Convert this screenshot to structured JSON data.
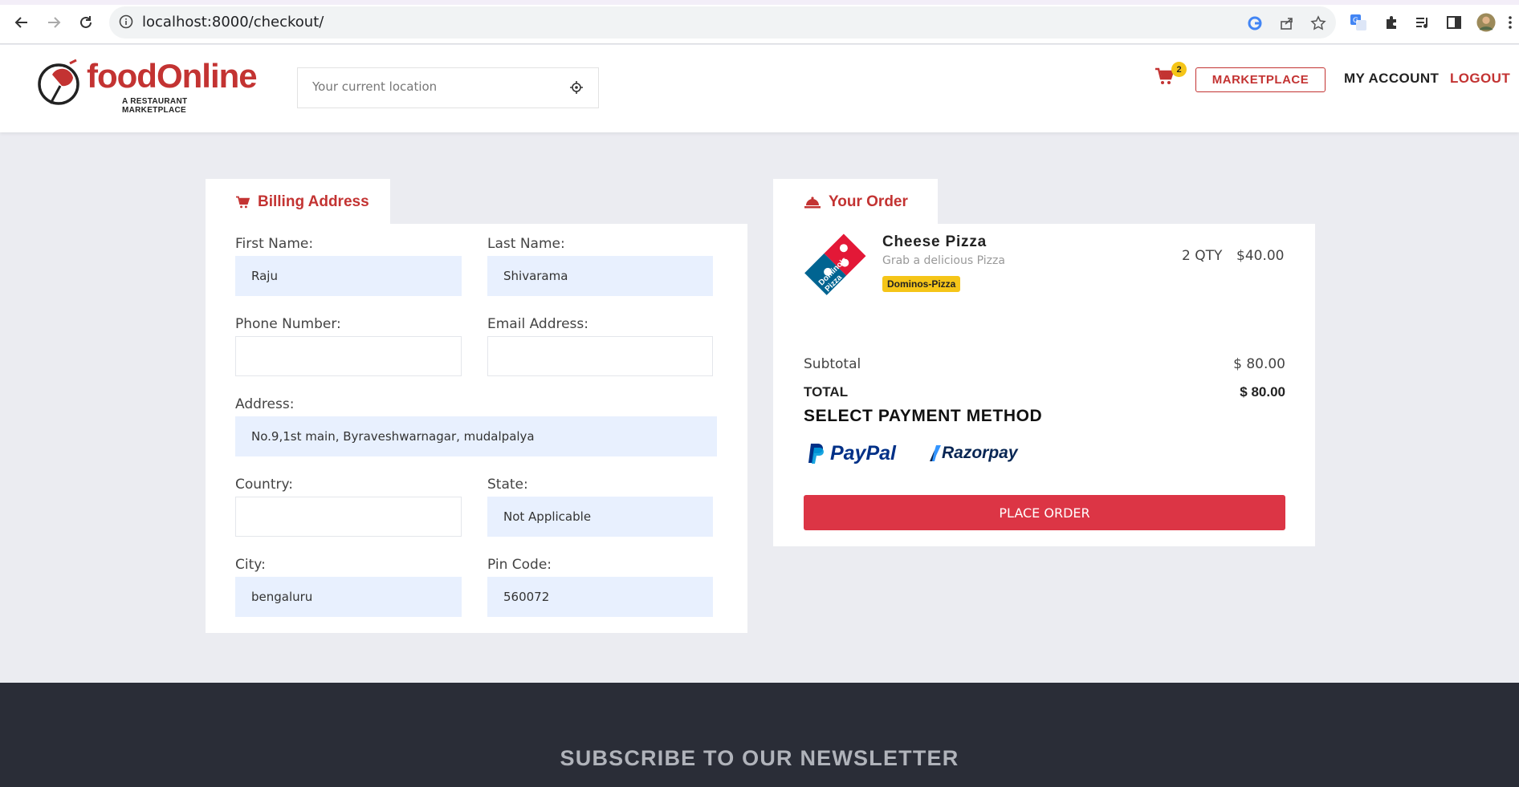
{
  "browser": {
    "url": "localhost:8000/checkout/"
  },
  "header": {
    "logo_text": "foodOnline",
    "logo_subtitle": "A RESTAURANT MARKETPLACE",
    "location_placeholder": "Your current location",
    "cart_count": "2",
    "marketplace_label": "MARKETPLACE",
    "my_account_label": "MY ACCOUNT",
    "logout_label": "LOGOUT"
  },
  "billing": {
    "tab_title": "Billing Address",
    "first_name": {
      "label": "First Name:",
      "value": "Raju"
    },
    "last_name": {
      "label": "Last Name:",
      "value": "Shivarama"
    },
    "phone": {
      "label": "Phone Number:",
      "value": ""
    },
    "email": {
      "label": "Email Address:",
      "value": ""
    },
    "address": {
      "label": "Address:",
      "value": "No.9,1st main, Byraveshwarnagar, mudalpalya"
    },
    "country": {
      "label": "Country:",
      "value": ""
    },
    "state": {
      "label": "State:",
      "value": "Not Applicable"
    },
    "city": {
      "label": "City:",
      "value": "bengaluru"
    },
    "pin_code": {
      "label": "Pin Code:",
      "value": "560072"
    }
  },
  "order": {
    "tab_title": "Your Order",
    "items": [
      {
        "name": "Cheese Pizza",
        "description": "Grab a delicious Pizza",
        "vendor": "Dominos-Pizza",
        "quantity": "2 QTY",
        "price": "$40.00",
        "logo_text": "Domino's Pizza"
      }
    ],
    "subtotal_label": "Subtotal",
    "subtotal_value": "$ 80.00",
    "total_label": "TOTAL",
    "total_value": "$ 80.00",
    "payment_title": "SELECT PAYMENT METHOD",
    "payment_methods": [
      "PayPal",
      "Razorpay"
    ],
    "place_order_label": "PLACE ORDER"
  },
  "footer": {
    "newsletter_title": "SUBSCRIBE TO OUR NEWSLETTER"
  },
  "colors": {
    "brand_red": "#c33332",
    "button_red": "#dc3545",
    "badge_yellow": "#f5c518",
    "autofill_blue": "#e8f0fe",
    "footer_bg": "#2a2d37",
    "page_bg": "#ebecf1"
  }
}
